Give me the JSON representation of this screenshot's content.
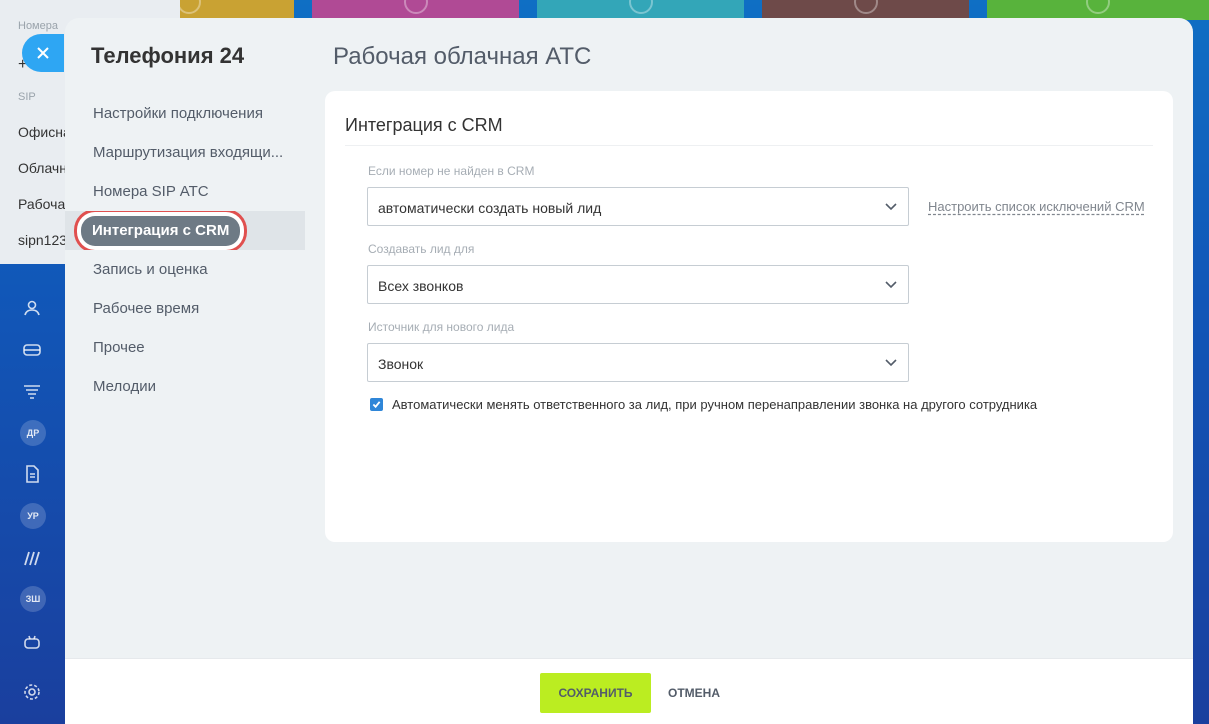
{
  "background": {
    "tile_colors": [
      "#c9a233",
      "#b04a95",
      "#33a6b8",
      "#6e4a49",
      "#58b33c"
    ]
  },
  "behind_panel": {
    "label_numbers": "Номера",
    "add_sign": "+",
    "label_sip": "SIP",
    "items": [
      "Офисна",
      "Облачн",
      "Рабоча",
      "sipn123"
    ]
  },
  "rail": {
    "badges": [
      "ДР",
      "УР",
      "ЗШ"
    ]
  },
  "sidebar": {
    "title": "Телефония 24",
    "items": [
      {
        "label": "Настройки подключения"
      },
      {
        "label": "Маршрутизация входящи..."
      },
      {
        "label": "Номера SIP АТС"
      },
      {
        "label": "Интеграция с CRM",
        "active": true
      },
      {
        "label": "Запись и оценка"
      },
      {
        "label": "Рабочее время"
      },
      {
        "label": "Прочее"
      },
      {
        "label": "Мелодии"
      }
    ]
  },
  "main": {
    "page_title": "Рабочая облачная АТС",
    "card_title": "Интеграция с CRM",
    "fields": [
      {
        "label": "Если номер не найден в CRM",
        "value": "автоматически создать новый лид"
      },
      {
        "label": "Создавать лид для",
        "value": "Всех звонков"
      },
      {
        "label": "Источник для нового лида",
        "value": "Звонок"
      }
    ],
    "exceptions_link": "Настроить список исключений CRM",
    "checkbox": {
      "checked": true,
      "label": "Автоматически менять ответственного за лид, при ручном перенаправлении звонка на другого сотрудника"
    }
  },
  "footer": {
    "save": "СОХРАНИТЬ",
    "cancel": "ОТМЕНА"
  },
  "colors": {
    "save_button": "#bbed21",
    "highlight_outline": "#e0504f",
    "checkbox": "#2f86d8",
    "close_button": "#2ea6f3"
  }
}
